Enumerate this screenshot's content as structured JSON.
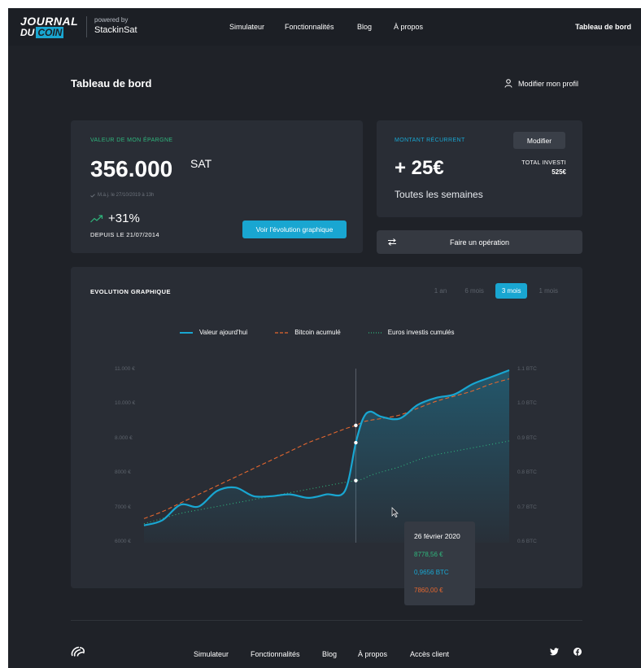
{
  "header": {
    "logo_top": "JOURNAL",
    "logo_du": "DU",
    "logo_coin": "COIN",
    "powered_by": "powered by",
    "powered_name": "StackinSat",
    "nav": [
      "Simulateur",
      "Fonctionnalités",
      "Blog",
      "À propos"
    ],
    "right_link": "Tableau de bord"
  },
  "page": {
    "title": "Tableau de bord",
    "profile_label": "Modifier mon profil",
    "profile_icon": "user-icon"
  },
  "savings": {
    "label": "VALEUR DE MON ÉPARGNE",
    "value": "356.000",
    "unit": "SAT",
    "updated": "M.à.j. le 27/10/2019 à 13h",
    "trend": "+31%",
    "since": "DEPUIS LE 21/07/2014",
    "button": "Voir l'évolution graphique",
    "accent": "#2fb57c"
  },
  "recurrent": {
    "label": "MONTANT RÉCURRENT",
    "button": "Modifier",
    "amount": "+ 25€",
    "frequency": "Toutes les semaines",
    "total_label": "TOTAL INVESTI",
    "total_value": "525€"
  },
  "operation": {
    "label": "Faire un opération",
    "icon": "swap-arrows-icon"
  },
  "chart_section": {
    "title": "EVOLUTION GRAPHIQUE",
    "periods": [
      {
        "label": "1 an",
        "active": false
      },
      {
        "label": "6 mois",
        "active": false
      },
      {
        "label": "3 mois",
        "active": true
      },
      {
        "label": "1 mois",
        "active": false
      }
    ],
    "legend": [
      "Valeur ajourd'hui",
      "Bitcoin acumulé",
      "Euros investis cumulés"
    ],
    "tooltip": {
      "date": "26 février 2020",
      "v1": "8778,56 €",
      "v2": "0,9656 BTC",
      "v3": "7860,00 €"
    }
  },
  "chart_data": {
    "type": "line",
    "title": "",
    "xlabel": "",
    "ylabel": "",
    "y_left_ticks": [
      "11.000 €",
      "10.000 €",
      "8.000 €",
      "8000 €",
      "7000 €",
      "6000 €"
    ],
    "y_right_ticks": [
      "1.1 BTC",
      "1.0 BTC",
      "0.9 BTC",
      "0.8 BTC",
      "0.7 BTC",
      "0.6 BTC"
    ],
    "ylim": [
      0,
      5
    ],
    "x": [
      0,
      0.05,
      0.1,
      0.15,
      0.2,
      0.25,
      0.3,
      0.35,
      0.4,
      0.45,
      0.5,
      0.55,
      0.58,
      0.6,
      0.62,
      0.65,
      0.7,
      0.75,
      0.8,
      0.85,
      0.9,
      0.95,
      1
    ],
    "series": [
      {
        "name": "Valeur ajourd'hui",
        "color": "#19a6d1",
        "style": "solid",
        "values": [
          0.5,
          0.65,
          1.1,
          1.05,
          1.5,
          1.6,
          1.35,
          1.35,
          1.4,
          1.3,
          1.4,
          1.5,
          2.9,
          3.6,
          3.8,
          3.65,
          3.6,
          4.0,
          4.2,
          4.3,
          4.6,
          4.8,
          5.0
        ]
      },
      {
        "name": "Bitcoin acumulé",
        "color": "#e4672f",
        "style": "dashed",
        "values": [
          0.7,
          0.9,
          1.15,
          1.4,
          1.65,
          1.9,
          2.15,
          2.4,
          2.65,
          2.9,
          3.1,
          3.3,
          3.4,
          3.5,
          3.55,
          3.6,
          3.7,
          3.9,
          4.1,
          4.25,
          4.4,
          4.6,
          4.75
        ]
      },
      {
        "name": "Euros investis cumulés",
        "color": "#2fb57c",
        "style": "dotted",
        "values": [
          0.55,
          0.7,
          0.85,
          0.95,
          1.05,
          1.15,
          1.25,
          1.35,
          1.45,
          1.55,
          1.65,
          1.75,
          1.8,
          1.85,
          1.95,
          2.05,
          2.2,
          2.4,
          2.55,
          2.65,
          2.75,
          2.85,
          2.95
        ]
      }
    ],
    "cursor_x": 0.58,
    "grid": false,
    "legend_position": "top-center"
  },
  "footer": {
    "nav": [
      "Simulateur",
      "Fonctionnalités",
      "Blog",
      "À propos",
      "Accès client"
    ],
    "logo_icon": "stackinsat-logo-icon",
    "social": [
      "twitter-icon",
      "facebook-icon"
    ]
  }
}
